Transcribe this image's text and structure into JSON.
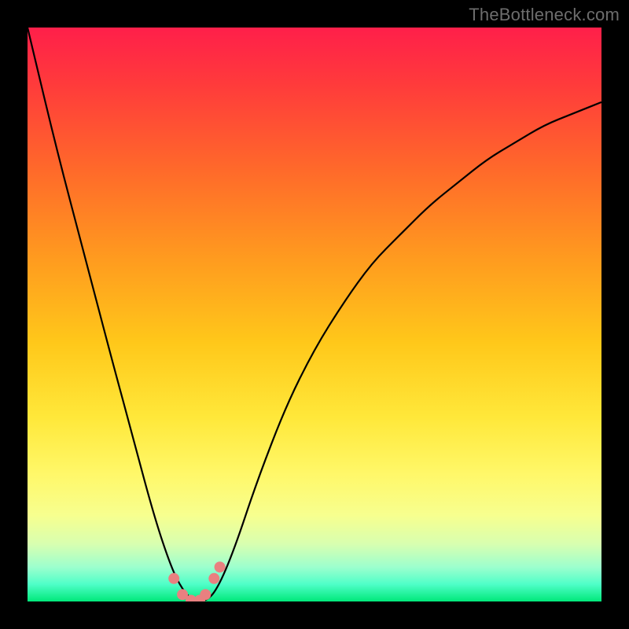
{
  "watermark": "TheBottleneck.com",
  "colors": {
    "background": "#000000",
    "gradient_top": "#ff1f4a",
    "gradient_bottom": "#00e87a",
    "curve": "#000000",
    "marker": "#e98080"
  },
  "chart_data": {
    "type": "line",
    "title": "",
    "xlabel": "",
    "ylabel": "",
    "xlim": [
      0,
      100
    ],
    "ylim": [
      0,
      100
    ],
    "grid": false,
    "legend": false,
    "x": [
      0,
      5,
      10,
      15,
      18,
      22,
      25,
      27,
      29,
      31,
      33,
      36,
      40,
      45,
      50,
      55,
      60,
      65,
      70,
      75,
      80,
      85,
      90,
      95,
      100
    ],
    "y": [
      100,
      79,
      60,
      41,
      30,
      15,
      6,
      2,
      0,
      0,
      2,
      9,
      21,
      34,
      44,
      52,
      59,
      64,
      69,
      73,
      77,
      80,
      83,
      85,
      87
    ],
    "markers": {
      "x": [
        25.5,
        27,
        28.5,
        30,
        31,
        32.5,
        33.5
      ],
      "y": [
        4,
        1.2,
        0.2,
        0.2,
        1.2,
        4,
        6
      ]
    },
    "notes": "Plot shows a bottleneck-style V-curve over a vertical red→green gradient background. Axes have no visible tick labels; values estimated relative to plot area (0–100 both axes, y increasing upward)."
  }
}
